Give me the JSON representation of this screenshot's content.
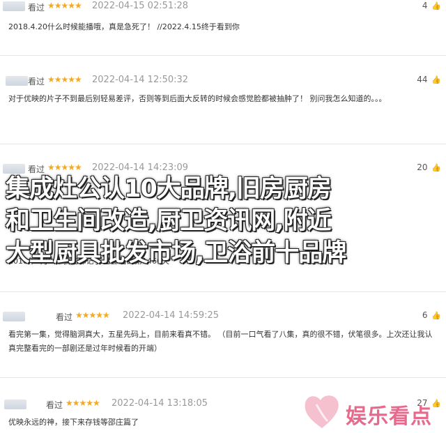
{
  "reviews": [
    {
      "user": "看过",
      "stars": "★★★★★",
      "time": "2022-04-15 02:51:28",
      "likes": "4",
      "text": "2018.4.20什么时候能播哦，真是急死了！ //2022.4.15终于看到你"
    },
    {
      "user": "看过",
      "stars": "★★★★★",
      "time": "2022-04-14 12:50:32",
      "likes": "44",
      "text": "对于优映的片子不到最后别轻易差评，否则等到后面大反转的时候会感觉脸都被抽肿了！ 别问我怎么知道的。。。"
    },
    {
      "user": "看过",
      "stars": "★★★★★",
      "time": "2022-04-14 14:23:09",
      "likes": "20",
      "text": "2018年4月9日 我啥都记了 急都看的第1466天"
    },
    {
      "user": "看过",
      "stars": "★★★★★",
      "time": "2022-04-14 14:59:25",
      "likes": "6",
      "text": "看完第一集，觉得脑洞真大，五星先码上，目前来看真不错。 （目前一口气看了八集，真的很不错，伏笔很多。上次还让我认真完整看完的一部剧还是过年时候看的开端）"
    },
    {
      "user": "看过",
      "stars": "★★★★★",
      "time": "2022-04-14 13:18:05",
      "likes": "27",
      "text": "优映永远的神，接下来存钱等邵庄篇了"
    }
  ],
  "overlay": {
    "line1": "集成灶公认10大品牌,旧房厨房",
    "line2": "和卫生间改造,厨卫资讯网,附近",
    "line3": "大型厨具批发市场,卫浴前十品牌"
  },
  "watermark": {
    "text": "娱乐看点"
  },
  "colors": {
    "star": "#f7a81b",
    "watermark": "#e66a8c"
  }
}
